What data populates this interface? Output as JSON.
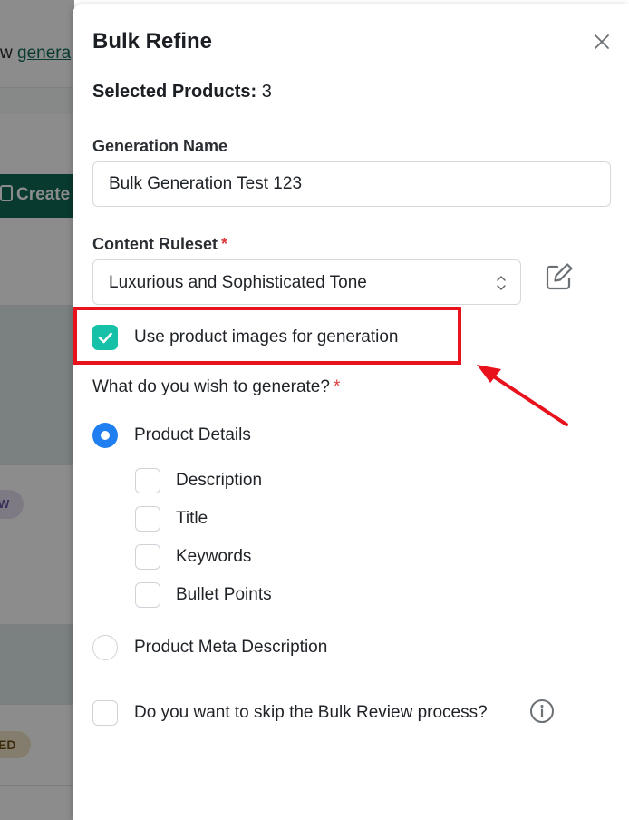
{
  "background": {
    "link_prefix": "w ",
    "link_text": "genera",
    "create_button": "Create",
    "badge_1": "W",
    "badge_2": "ED"
  },
  "drawer": {
    "title": "Bulk Refine",
    "selected_label": "Selected Products:",
    "selected_count": "3",
    "generation_name": {
      "label": "Generation Name",
      "value": "Bulk Generation Test 123"
    },
    "content_ruleset": {
      "label": "Content Ruleset",
      "required_mark": "*",
      "value": "Luxurious and Sophisticated Tone"
    },
    "use_images": {
      "label": "Use product images for generation",
      "checked": true
    },
    "generate_question": {
      "label": "What do you wish to generate?",
      "required_mark": "*"
    },
    "options": {
      "product_details": {
        "label": "Product Details",
        "selected": true
      },
      "sub_options": [
        {
          "label": "Description",
          "checked": false
        },
        {
          "label": "Title",
          "checked": false
        },
        {
          "label": "Keywords",
          "checked": false
        },
        {
          "label": "Bullet Points",
          "checked": false
        }
      ],
      "meta_description": {
        "label": "Product Meta Description",
        "selected": false
      }
    },
    "skip_review": {
      "label": "Do you want to skip the Bulk Review process?",
      "checked": false
    }
  },
  "colors": {
    "accent_teal": "#16c1a7",
    "radio_blue": "#1f7ff0",
    "highlight_red": "#e8121c",
    "required_red": "#e03b3b"
  },
  "icons": [
    "close-icon",
    "select-arrows-icon",
    "edit-icon",
    "check-icon",
    "info-icon",
    "arrow-annotation"
  ]
}
